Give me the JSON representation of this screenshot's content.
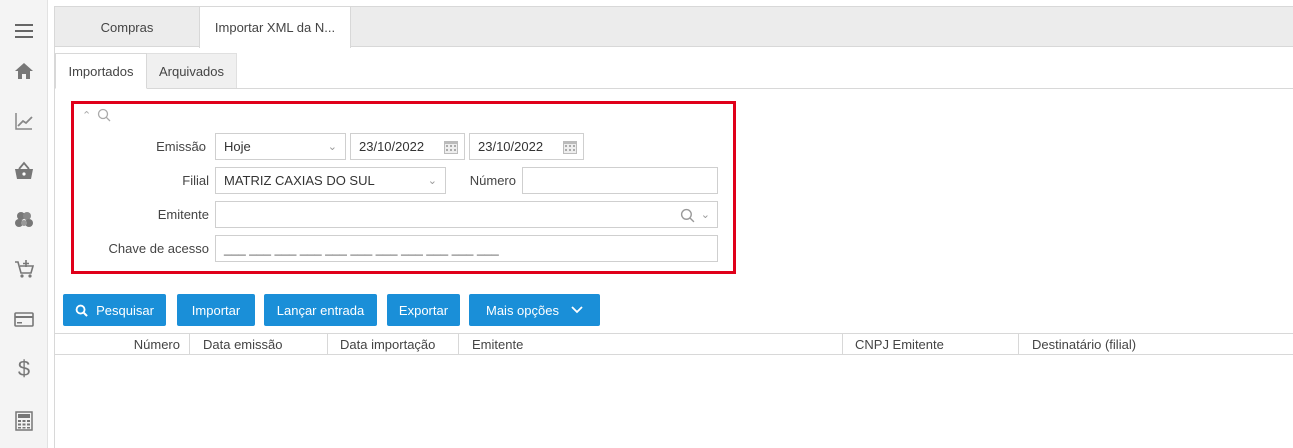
{
  "tabs": {
    "compras": "Compras",
    "importar": "Importar XML da N..."
  },
  "subtabs": {
    "importados": "Importados",
    "arquivados": "Arquivados"
  },
  "filters": {
    "emissao_label": "Emissão",
    "emissao_period": "Hoje",
    "date_from": "23/10/2022",
    "date_to": "23/10/2022",
    "filial_label": "Filial",
    "filial_value": "MATRIZ CAXIAS DO SUL",
    "numero_label": "Número",
    "numero_value": "",
    "emitente_label": "Emitente",
    "emitente_value": "",
    "chave_label": "Chave de acesso",
    "chave_mask": "___ ___ ___ ___ ___ ___ ___ ___ ___ ___ ___"
  },
  "buttons": {
    "pesquisar": "Pesquisar",
    "importar": "Importar",
    "lancar": "Lançar entrada",
    "exportar": "Exportar",
    "mais": "Mais opções"
  },
  "columns": [
    "Número",
    "Data emissão",
    "Data importação",
    "Emitente",
    "CNPJ Emitente",
    "Destinatário (filial)"
  ],
  "colors": {
    "primary": "#1a8fd8",
    "highlight": "#e0001a"
  },
  "rail_icons": [
    "menu-icon",
    "home-icon",
    "chart-icon",
    "basket-icon",
    "boxes-icon",
    "cart-add-icon",
    "card-icon",
    "dollar-icon",
    "calculator-icon"
  ]
}
